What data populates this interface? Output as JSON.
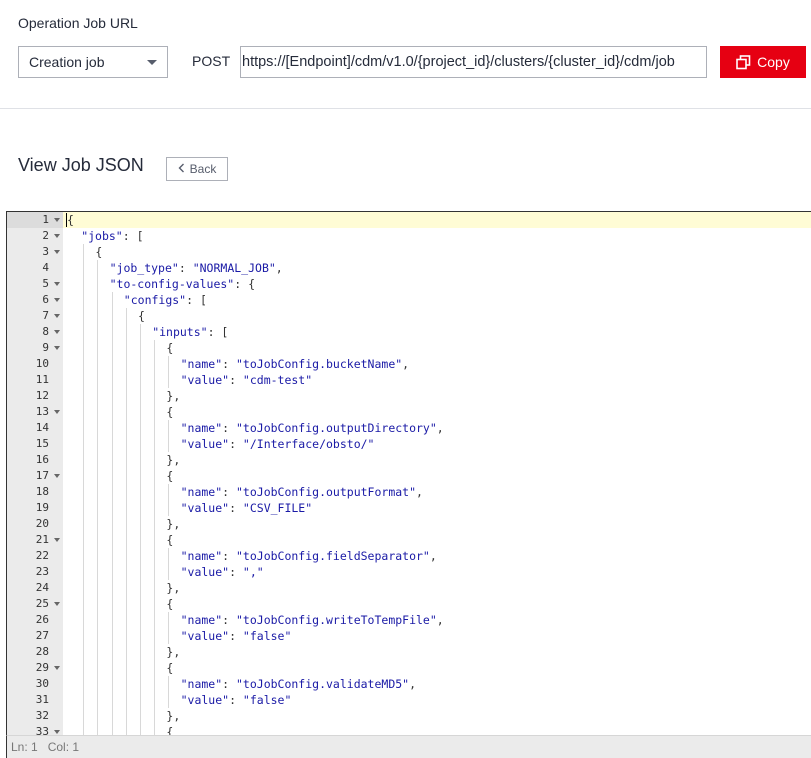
{
  "header": {
    "section_label": "Operation Job URL",
    "job_select": {
      "value": "Creation job"
    },
    "method": "POST",
    "url": "https://[Endpoint]/cdm/v1.0/{project_id}/clusters/{cluster_id}/cdm/job",
    "copy_label": "Copy",
    "copy_color": "#e60012"
  },
  "view": {
    "title": "View Job JSON",
    "back_label": "Back"
  },
  "editor": {
    "active_line": 1,
    "colors": {
      "key": "#1a1aa6",
      "string": "#1a1aa6",
      "punct": "#333333",
      "active_line_bg": "#fffcd5",
      "gutter_bg": "#ebebeb"
    },
    "lines": [
      {
        "n": "1",
        "indent": 0,
        "fold": true,
        "text": "{"
      },
      {
        "n": "2",
        "indent": 1,
        "fold": true,
        "key": "\"jobs\"",
        "text": ": ["
      },
      {
        "n": "3",
        "indent": 2,
        "fold": true,
        "text": "{"
      },
      {
        "n": "4",
        "indent": 3,
        "fold": false,
        "key": "\"job_type\"",
        "text": ": ",
        "str": "\"NORMAL_JOB\"",
        "tail": ","
      },
      {
        "n": "5",
        "indent": 3,
        "fold": true,
        "key": "\"to-config-values\"",
        "text": ": {"
      },
      {
        "n": "6",
        "indent": 4,
        "fold": true,
        "key": "\"configs\"",
        "text": ": ["
      },
      {
        "n": "7",
        "indent": 5,
        "fold": true,
        "text": "{"
      },
      {
        "n": "8",
        "indent": 6,
        "fold": true,
        "key": "\"inputs\"",
        "text": ": ["
      },
      {
        "n": "9",
        "indent": 7,
        "fold": true,
        "text": "{"
      },
      {
        "n": "10",
        "indent": 8,
        "fold": false,
        "key": "\"name\"",
        "text": ": ",
        "str": "\"toJobConfig.bucketName\"",
        "tail": ","
      },
      {
        "n": "11",
        "indent": 8,
        "fold": false,
        "key": "\"value\"",
        "text": ": ",
        "str": "\"cdm-test\"",
        "tail": ""
      },
      {
        "n": "12",
        "indent": 7,
        "fold": false,
        "text": "},"
      },
      {
        "n": "13",
        "indent": 7,
        "fold": true,
        "text": "{"
      },
      {
        "n": "14",
        "indent": 8,
        "fold": false,
        "key": "\"name\"",
        "text": ": ",
        "str": "\"toJobConfig.outputDirectory\"",
        "tail": ","
      },
      {
        "n": "15",
        "indent": 8,
        "fold": false,
        "key": "\"value\"",
        "text": ": ",
        "str": "\"/Interface/obsto/\"",
        "tail": ""
      },
      {
        "n": "16",
        "indent": 7,
        "fold": false,
        "text": "},"
      },
      {
        "n": "17",
        "indent": 7,
        "fold": true,
        "text": "{"
      },
      {
        "n": "18",
        "indent": 8,
        "fold": false,
        "key": "\"name\"",
        "text": ": ",
        "str": "\"toJobConfig.outputFormat\"",
        "tail": ","
      },
      {
        "n": "19",
        "indent": 8,
        "fold": false,
        "key": "\"value\"",
        "text": ": ",
        "str": "\"CSV_FILE\"",
        "tail": ""
      },
      {
        "n": "20",
        "indent": 7,
        "fold": false,
        "text": "},"
      },
      {
        "n": "21",
        "indent": 7,
        "fold": true,
        "text": "{"
      },
      {
        "n": "22",
        "indent": 8,
        "fold": false,
        "key": "\"name\"",
        "text": ": ",
        "str": "\"toJobConfig.fieldSeparator\"",
        "tail": ","
      },
      {
        "n": "23",
        "indent": 8,
        "fold": false,
        "key": "\"value\"",
        "text": ": ",
        "str": "\",\"",
        "tail": ""
      },
      {
        "n": "24",
        "indent": 7,
        "fold": false,
        "text": "},"
      },
      {
        "n": "25",
        "indent": 7,
        "fold": true,
        "text": "{"
      },
      {
        "n": "26",
        "indent": 8,
        "fold": false,
        "key": "\"name\"",
        "text": ": ",
        "str": "\"toJobConfig.writeToTempFile\"",
        "tail": ","
      },
      {
        "n": "27",
        "indent": 8,
        "fold": false,
        "key": "\"value\"",
        "text": ": ",
        "str": "\"false\"",
        "tail": ""
      },
      {
        "n": "28",
        "indent": 7,
        "fold": false,
        "text": "},"
      },
      {
        "n": "29",
        "indent": 7,
        "fold": true,
        "text": "{"
      },
      {
        "n": "30",
        "indent": 8,
        "fold": false,
        "key": "\"name\"",
        "text": ": ",
        "str": "\"toJobConfig.validateMD5\"",
        "tail": ","
      },
      {
        "n": "31",
        "indent": 8,
        "fold": false,
        "key": "\"value\"",
        "text": ": ",
        "str": "\"false\"",
        "tail": ""
      },
      {
        "n": "32",
        "indent": 7,
        "fold": false,
        "text": "},"
      },
      {
        "n": "33",
        "indent": 7,
        "fold": true,
        "text": "{"
      }
    ]
  },
  "status": {
    "line": "Ln: 1",
    "col": "Col: 1"
  }
}
